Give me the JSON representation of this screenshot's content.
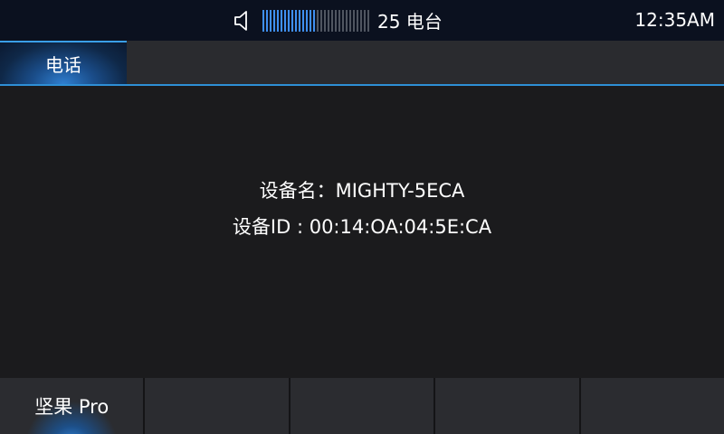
{
  "status_bar": {
    "volume": {
      "level": 15,
      "max": 30,
      "icon": "speaker-icon"
    },
    "station": "25 电台",
    "clock": "12:35AM"
  },
  "tabs": [
    {
      "label": "电话",
      "active": true
    }
  ],
  "device": {
    "name_line": "设备名：MIGHTY-5ECA",
    "id_line": "设备ID : 00:14:OA:04:5E:CA"
  },
  "dock": {
    "slots": [
      {
        "label": "坚果  Pro",
        "active": true
      },
      {
        "label": ""
      },
      {
        "label": ""
      },
      {
        "label": ""
      },
      {
        "label": ""
      }
    ]
  },
  "colors": {
    "accent": "#2e8fd6",
    "volume_on": "#3f8ff0",
    "volume_off": "#4f5560",
    "background": "#1b1b1d"
  }
}
